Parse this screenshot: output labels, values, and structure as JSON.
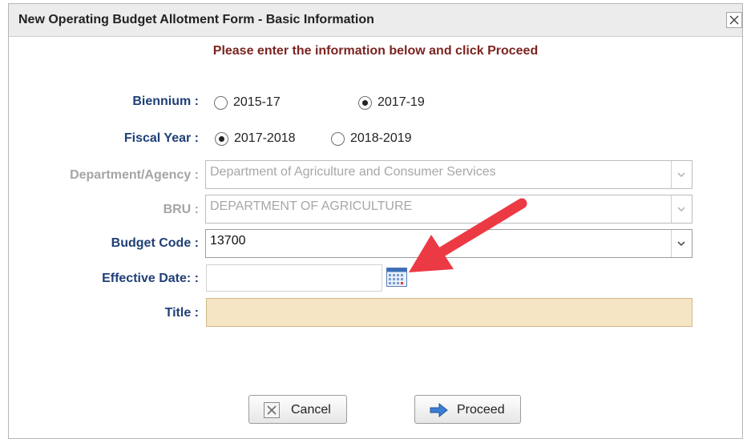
{
  "dialog": {
    "title": "New Operating Budget Allotment Form - Basic Information",
    "instructions": "Please enter the information below and click Proceed"
  },
  "form": {
    "biennium": {
      "label": "Biennium :",
      "options": [
        {
          "label": "2015-17",
          "selected": false
        },
        {
          "label": "2017-19",
          "selected": true
        }
      ]
    },
    "fiscal_year": {
      "label": "Fiscal Year :",
      "options": [
        {
          "label": "2017-2018",
          "selected": true
        },
        {
          "label": "2018-2019",
          "selected": false
        }
      ]
    },
    "department": {
      "label": "Department/Agency :",
      "value": "Department of Agriculture and Consumer Services",
      "disabled": true
    },
    "bru": {
      "label": "BRU :",
      "value": "DEPARTMENT OF AGRICULTURE",
      "disabled": true
    },
    "budget_code": {
      "label": "Budget Code :",
      "value": "13700"
    },
    "effective_date": {
      "label": "Effective Date: :",
      "value": ""
    },
    "title_field": {
      "label": "Title :",
      "value": ""
    }
  },
  "buttons": {
    "cancel": "Cancel",
    "proceed": "Proceed"
  },
  "colors": {
    "label": "#1f3f77",
    "instructions": "#7b2421",
    "title_input_bg": "#f6e5c4",
    "annotation_arrow": "#ec3a45"
  },
  "annotation": {
    "type": "arrow",
    "points_to": "calendar-icon"
  }
}
